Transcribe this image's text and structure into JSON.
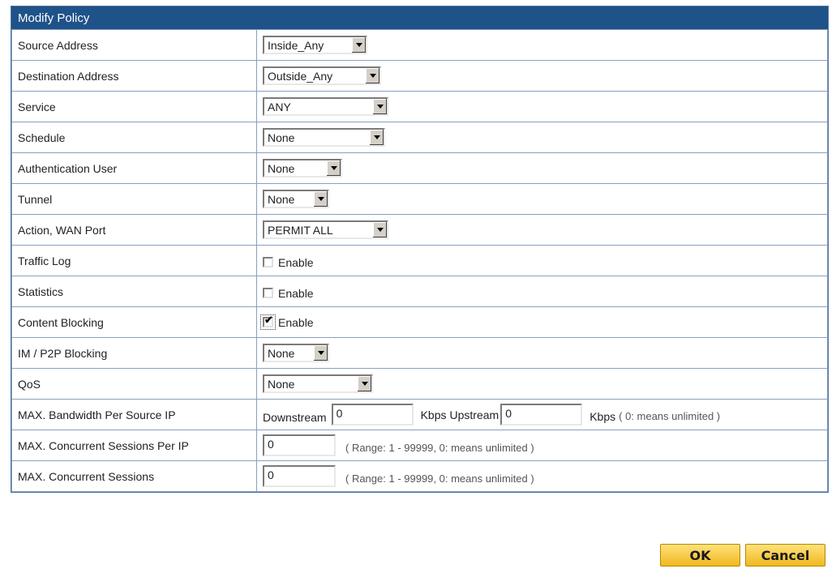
{
  "panel": {
    "title": "Modify Policy"
  },
  "rows": {
    "source_address": {
      "label": "Source Address",
      "value": "Inside_Any"
    },
    "destination_address": {
      "label": "Destination Address",
      "value": "Outside_Any"
    },
    "service": {
      "label": "Service",
      "value": "ANY"
    },
    "schedule": {
      "label": "Schedule",
      "value": "None"
    },
    "auth_user": {
      "label": "Authentication User",
      "value": "None"
    },
    "tunnel": {
      "label": "Tunnel",
      "value": "None"
    },
    "action_wan": {
      "label": "Action, WAN Port",
      "value": "PERMIT ALL"
    },
    "traffic_log": {
      "label": "Traffic Log",
      "checkbox_label": "Enable",
      "checked": false
    },
    "statistics": {
      "label": "Statistics",
      "checkbox_label": "Enable",
      "checked": false
    },
    "content_blocking": {
      "label": "Content Blocking",
      "checkbox_label": "Enable",
      "checked": true,
      "checkmark": "✔"
    },
    "im_p2p": {
      "label": "IM / P2P Blocking",
      "value": "None"
    },
    "qos": {
      "label": "QoS",
      "value": "None"
    },
    "max_bandwidth": {
      "label": "MAX. Bandwidth Per Source IP",
      "downstream_label": "Downstream",
      "downstream_value": "0",
      "unit1": "Kbps",
      "upstream_label": "Upstream",
      "upstream_value": "0",
      "unit2": "Kbps",
      "note": "( 0: means unlimited )"
    },
    "max_sessions_per_ip": {
      "label": "MAX. Concurrent Sessions Per IP",
      "value": "0",
      "note": "( Range: 1 - 99999, 0: means unlimited )"
    },
    "max_sessions": {
      "label": "MAX. Concurrent Sessions",
      "value": "0",
      "note": "( Range: 1 - 99999, 0: means unlimited )"
    }
  },
  "buttons": {
    "ok": "OK",
    "cancel": "Cancel"
  }
}
